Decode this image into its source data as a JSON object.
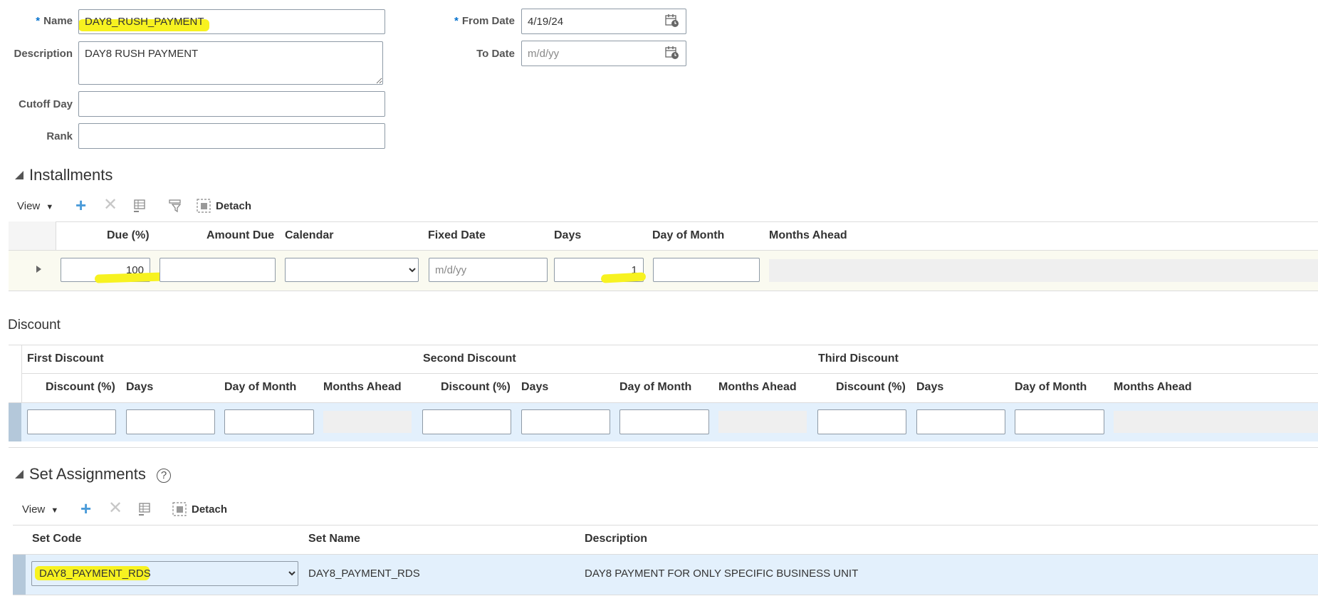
{
  "form": {
    "name_label": "Name",
    "name_value": "DAY8_RUSH_PAYMENT",
    "description_label": "Description",
    "description_value": "DAY8 RUSH PAYMENT",
    "cutoff_label": "Cutoff Day",
    "cutoff_value": "",
    "rank_label": "Rank",
    "rank_value": "",
    "from_date_label": "From Date",
    "from_date_value": "4/19/24",
    "to_date_label": "To Date",
    "to_date_placeholder": "m/d/yy",
    "required_mark": "*"
  },
  "installments": {
    "title": "Installments",
    "toolbar": {
      "view_label": "View",
      "detach_label": "Detach"
    },
    "columns": [
      "Due (%)",
      "Amount Due",
      "Calendar",
      "Fixed Date",
      "Days",
      "Day of Month",
      "Months Ahead"
    ],
    "row": {
      "due_pct": "100",
      "amount_due": "",
      "calendar": "",
      "fixed_date_placeholder": "m/d/yy",
      "days": "1",
      "day_of_month": ""
    }
  },
  "discount": {
    "title": "Discount",
    "groups": [
      "First Discount",
      "Second Discount",
      "Third Discount"
    ],
    "columns": [
      "Discount (%)",
      "Days",
      "Day of Month",
      "Months Ahead"
    ]
  },
  "set_assignments": {
    "title": "Set Assignments",
    "help": "?",
    "toolbar": {
      "view_label": "View",
      "detach_label": "Detach"
    },
    "columns": [
      "Set Code",
      "Set Name",
      "Description"
    ],
    "row": {
      "set_code": "DAY8_PAYMENT_RDS",
      "set_name": "DAY8_PAYMENT_RDS",
      "description": "DAY8 PAYMENT FOR ONLY SPECIFIC BUSINESS UNIT"
    }
  },
  "colors": {
    "highlight": "#f7f220",
    "row_select": "#e3f0fc",
    "row_bar": "#b4c8da",
    "accent_blue": "#0572ce"
  }
}
